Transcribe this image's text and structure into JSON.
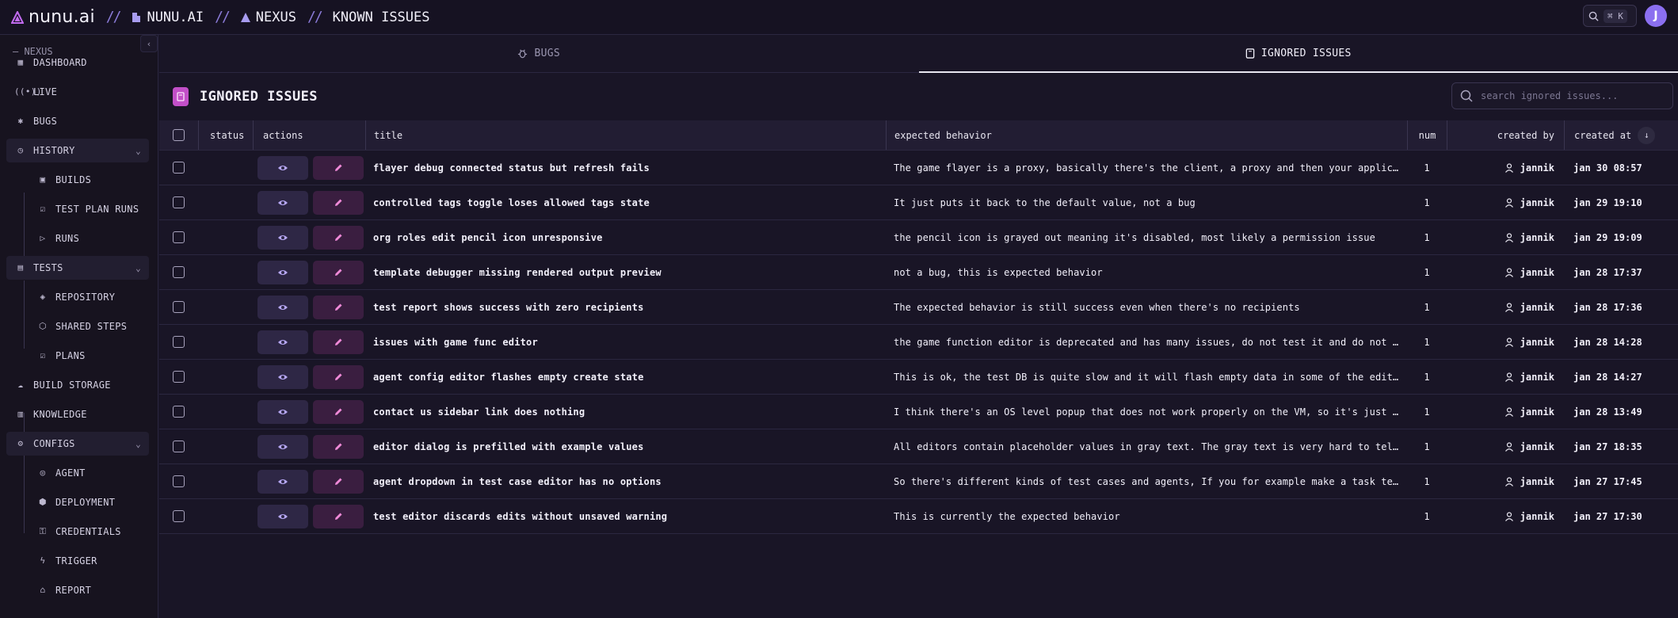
{
  "topbar": {
    "logo_text": "nunu.ai",
    "breadcrumb": [
      "NUNU.AI",
      "NEXUS",
      "KNOWN ISSUES"
    ],
    "search_shortcut": "⌘ K",
    "avatar_initial": "J"
  },
  "sidebar": {
    "section_label": "— NEXUS",
    "items": [
      {
        "label": "DASHBOARD",
        "icon": "dashboard-icon"
      },
      {
        "label": "LIVE",
        "icon": "live-icon"
      },
      {
        "label": "BUGS",
        "icon": "bug-icon"
      },
      {
        "label": "HISTORY",
        "icon": "history-icon",
        "expanded": true
      },
      {
        "label": "BUILDS",
        "icon": "builds-icon"
      },
      {
        "label": "TEST PLAN RUNS",
        "icon": "test-plan-runs-icon"
      },
      {
        "label": "RUNS",
        "icon": "play-icon"
      },
      {
        "label": "TESTS",
        "icon": "clipboard-icon",
        "expanded": true
      },
      {
        "label": "REPOSITORY",
        "icon": "layers-icon"
      },
      {
        "label": "SHARED STEPS",
        "icon": "shared-steps-icon"
      },
      {
        "label": "PLANS",
        "icon": "plans-icon"
      },
      {
        "label": "BUILD STORAGE",
        "icon": "cloud-icon"
      },
      {
        "label": "KNOWLEDGE",
        "icon": "book-icon"
      },
      {
        "label": "CONFIGS",
        "icon": "gear-icon",
        "expanded": true
      },
      {
        "label": "AGENT",
        "icon": "agent-icon"
      },
      {
        "label": "DEPLOYMENT",
        "icon": "box-icon"
      },
      {
        "label": "CREDENTIALS",
        "icon": "key-icon"
      },
      {
        "label": "TRIGGER",
        "icon": "bolt-icon"
      },
      {
        "label": "REPORT",
        "icon": "report-icon"
      }
    ]
  },
  "tabs": [
    {
      "label": "BUGS",
      "active": false
    },
    {
      "label": "IGNORED ISSUES",
      "active": true
    }
  ],
  "page": {
    "title": "IGNORED ISSUES",
    "search_placeholder": "search ignored issues..."
  },
  "table": {
    "columns": [
      "status",
      "actions",
      "title",
      "expected behavior",
      "num",
      "created by",
      "created at"
    ],
    "rows": [
      {
        "title": "flayer debug connected status but refresh fails",
        "expected": "The game flayer is a proxy, basically there's the client, a proxy and then your application...",
        "num": "1",
        "by": "jannik",
        "at": "jan 30 08:57"
      },
      {
        "title": "controlled tags toggle loses allowed tags state",
        "expected": "It just puts it back to the default value, not a bug",
        "num": "1",
        "by": "jannik",
        "at": "jan 29 19:10"
      },
      {
        "title": "org roles edit pencil icon unresponsive",
        "expected": "the pencil icon is grayed out meaning it's disabled, most likely a permission issue",
        "num": "1",
        "by": "jannik",
        "at": "jan 29 19:09"
      },
      {
        "title": "template debugger missing rendered output preview",
        "expected": "not a bug, this is expected behavior",
        "num": "1",
        "by": "jannik",
        "at": "jan 28 17:37"
      },
      {
        "title": "test report shows success with zero recipients",
        "expected": "The expected behavior is still success even when there's no recipients",
        "num": "1",
        "by": "jannik",
        "at": "jan 28 17:36"
      },
      {
        "title": "issues with game func editor",
        "expected": "the game function editor is deprecated and has many issues, do not test it and do not report...",
        "num": "1",
        "by": "jannik",
        "at": "jan 28 14:28"
      },
      {
        "title": "agent config editor flashes empty create state",
        "expected": "This is ok, the test DB is quite slow and it will flash empty data in some of the editors...",
        "num": "1",
        "by": "jannik",
        "at": "jan 28 14:27"
      },
      {
        "title": "contact us sidebar link does nothing",
        "expected": "I think there's an OS level popup that does not work properly on the VM, so it's just ok...",
        "num": "1",
        "by": "jannik",
        "at": "jan 28 13:49"
      },
      {
        "title": "editor dialog is prefilled with example values",
        "expected": "All editors contain placeholder values in gray text. The gray text is very hard to tell...",
        "num": "1",
        "by": "jannik",
        "at": "jan 27 18:35"
      },
      {
        "title": "agent dropdown in test case editor has no options",
        "expected": "So there's different kinds of test cases and agents, If you for example make a task test...",
        "num": "1",
        "by": "jannik",
        "at": "jan 27 17:45"
      },
      {
        "title": "test editor discards edits without unsaved warning",
        "expected": "This is currently the expected behavior",
        "num": "1",
        "by": "jannik",
        "at": "jan 27 17:30"
      }
    ]
  },
  "colors": {
    "accent": "#8b6ff0",
    "edit_button": "#3a1e40",
    "view_button": "#2e2745",
    "page_icon": "#c24fc8"
  }
}
